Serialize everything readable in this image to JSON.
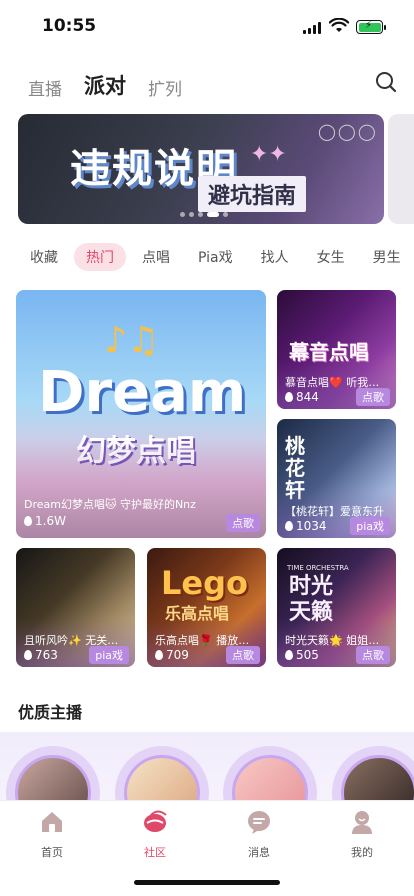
{
  "status_bar": {
    "time": "10:55"
  },
  "top_tabs": [
    {
      "label": "直播",
      "active": false
    },
    {
      "label": "派对",
      "active": true
    },
    {
      "label": "扩列",
      "active": false
    }
  ],
  "banner": {
    "title": "违规说明",
    "subtitle": "避坑指南",
    "page_index": 4,
    "page_count": 5
  },
  "categories": [
    {
      "label": "收藏",
      "active": false
    },
    {
      "label": "热门",
      "active": true
    },
    {
      "label": "点唱",
      "active": false
    },
    {
      "label": "Pia戏",
      "active": false
    },
    {
      "label": "找人",
      "active": false
    },
    {
      "label": "女生",
      "active": false
    },
    {
      "label": "男生",
      "active": false
    }
  ],
  "rooms": [
    {
      "art": "Dream",
      "art_sub": "幻梦点唱",
      "title": "Dream幻梦点唱🐱 守护最好的Nnz",
      "count": "1.6W",
      "tag": "点歌"
    },
    {
      "art": "幕音点唱",
      "title": "慕音点唱❤️ 听我音 暖",
      "count": "844",
      "tag": "点歌"
    },
    {
      "art": "桃花轩",
      "title": "【桃花轩】爱意东升",
      "count": "1034",
      "tag": "pia戏"
    },
    {
      "title": "且听风吟✨ 无关风月",
      "count": "763",
      "tag": "pia戏"
    },
    {
      "art": "Lego",
      "art_sub": "乐高点唱",
      "title": "乐高点唱🌹 播放器生",
      "count": "709",
      "tag": "点歌"
    },
    {
      "art": "时光天籁",
      "art_sub": "TIME ORCHESTRA",
      "title": "时光天籁🌟 姐姐最好",
      "count": "505",
      "tag": "点歌"
    }
  ],
  "section": {
    "title": "优质主播"
  },
  "tabbar": [
    {
      "label": "首页",
      "icon": "home-icon",
      "active": false
    },
    {
      "label": "社区",
      "icon": "community-icon",
      "active": true
    },
    {
      "label": "消息",
      "icon": "message-icon",
      "active": false
    },
    {
      "label": "我的",
      "icon": "profile-icon",
      "active": false
    }
  ],
  "colors": {
    "accent": "#e0486a",
    "tag_purple": "#b788e0",
    "cat_active_bg": "#fbe0e6"
  }
}
